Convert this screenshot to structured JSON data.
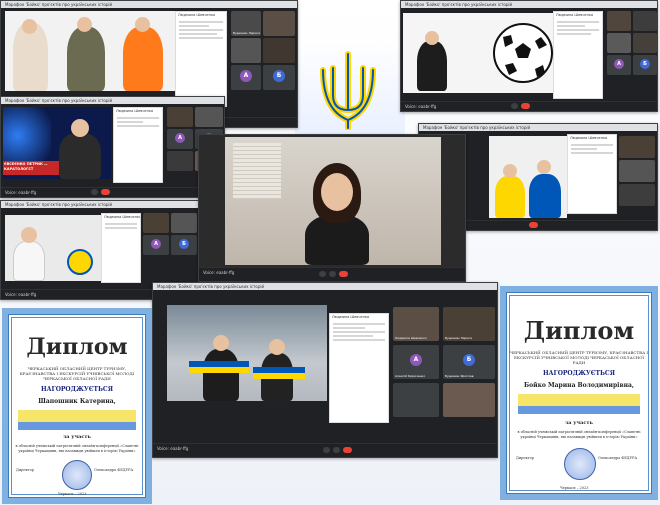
{
  "meet_title": "Марафон 'Бойко' про'єктів про українських історій",
  "meet_code": "Voice: eaabr-ffg",
  "participant_a": "Людмила Шевченко",
  "participant_b": "Будишин Лариса",
  "participant_c": "Алексій Кириченко",
  "participant_d": "Будишин Ярослав",
  "avatar_letters": [
    "А",
    "Б",
    "А",
    "Б"
  ],
  "caption_overlay": "ЄВСЕЄНКО ПЕТРИК — КАРАТОЛОГСТ",
  "certificate_left": {
    "title": "Диплом",
    "org": "ЧЕРКАСЬКИЙ ОБЛАСНИЙ ЦЕНТР ТУРИЗМУ, КРАЄЗНАВСТВА І ЕКСКУРСІЙ УЧНІВСЬКОЇ МОЛОДІ ЧЕРКАСЬКОЇ ОБЛАСНОЇ РАДИ",
    "award": "НАГОРОДЖУЄТЬСЯ",
    "name": "Шапошник Катерина,",
    "participation": "за участь",
    "event": "в обласній учнівській патріотичній онлайн-конференції «Славетні українці Черкащини, які назавжди увійшли в історію України»",
    "director": "Директор",
    "signee": "Олександра ФЕДУРА",
    "city_year": "Черкаси – 2023"
  },
  "certificate_right": {
    "title": "Диплом",
    "org": "ЧЕРКАСЬКИЙ ОБЛАСНИЙ ЦЕНТР ТУРИЗМУ, КРАЄЗНАВСТВА І ЕКСКУРСІЙ УЧНІВСЬКОЇ МОЛОДІ ЧЕРКАСЬКОЇ ОБЛАСНОЇ РАДИ",
    "award": "НАГОРОДЖУЄТЬСЯ",
    "name": "Бойко Марина Володимирівна,",
    "participation": "за участь",
    "event": "в обласній учнівській патріотичній онлайн-конференції «Славетні українці Черкащини, які назавжди увійшли в історію України»",
    "director": "Директор",
    "signee": "Олександра ФЕДУРА",
    "city_year": "Черкаси – 2023"
  },
  "colors": {
    "meet_dark": "#202124",
    "ua_blue": "#0057b8",
    "ua_yellow": "#ffd700",
    "cert_border": "#7fb0e0",
    "avatar_purple": "#8e59b6",
    "avatar_blue": "#3f6ad8",
    "leave_red": "#ea4335"
  }
}
